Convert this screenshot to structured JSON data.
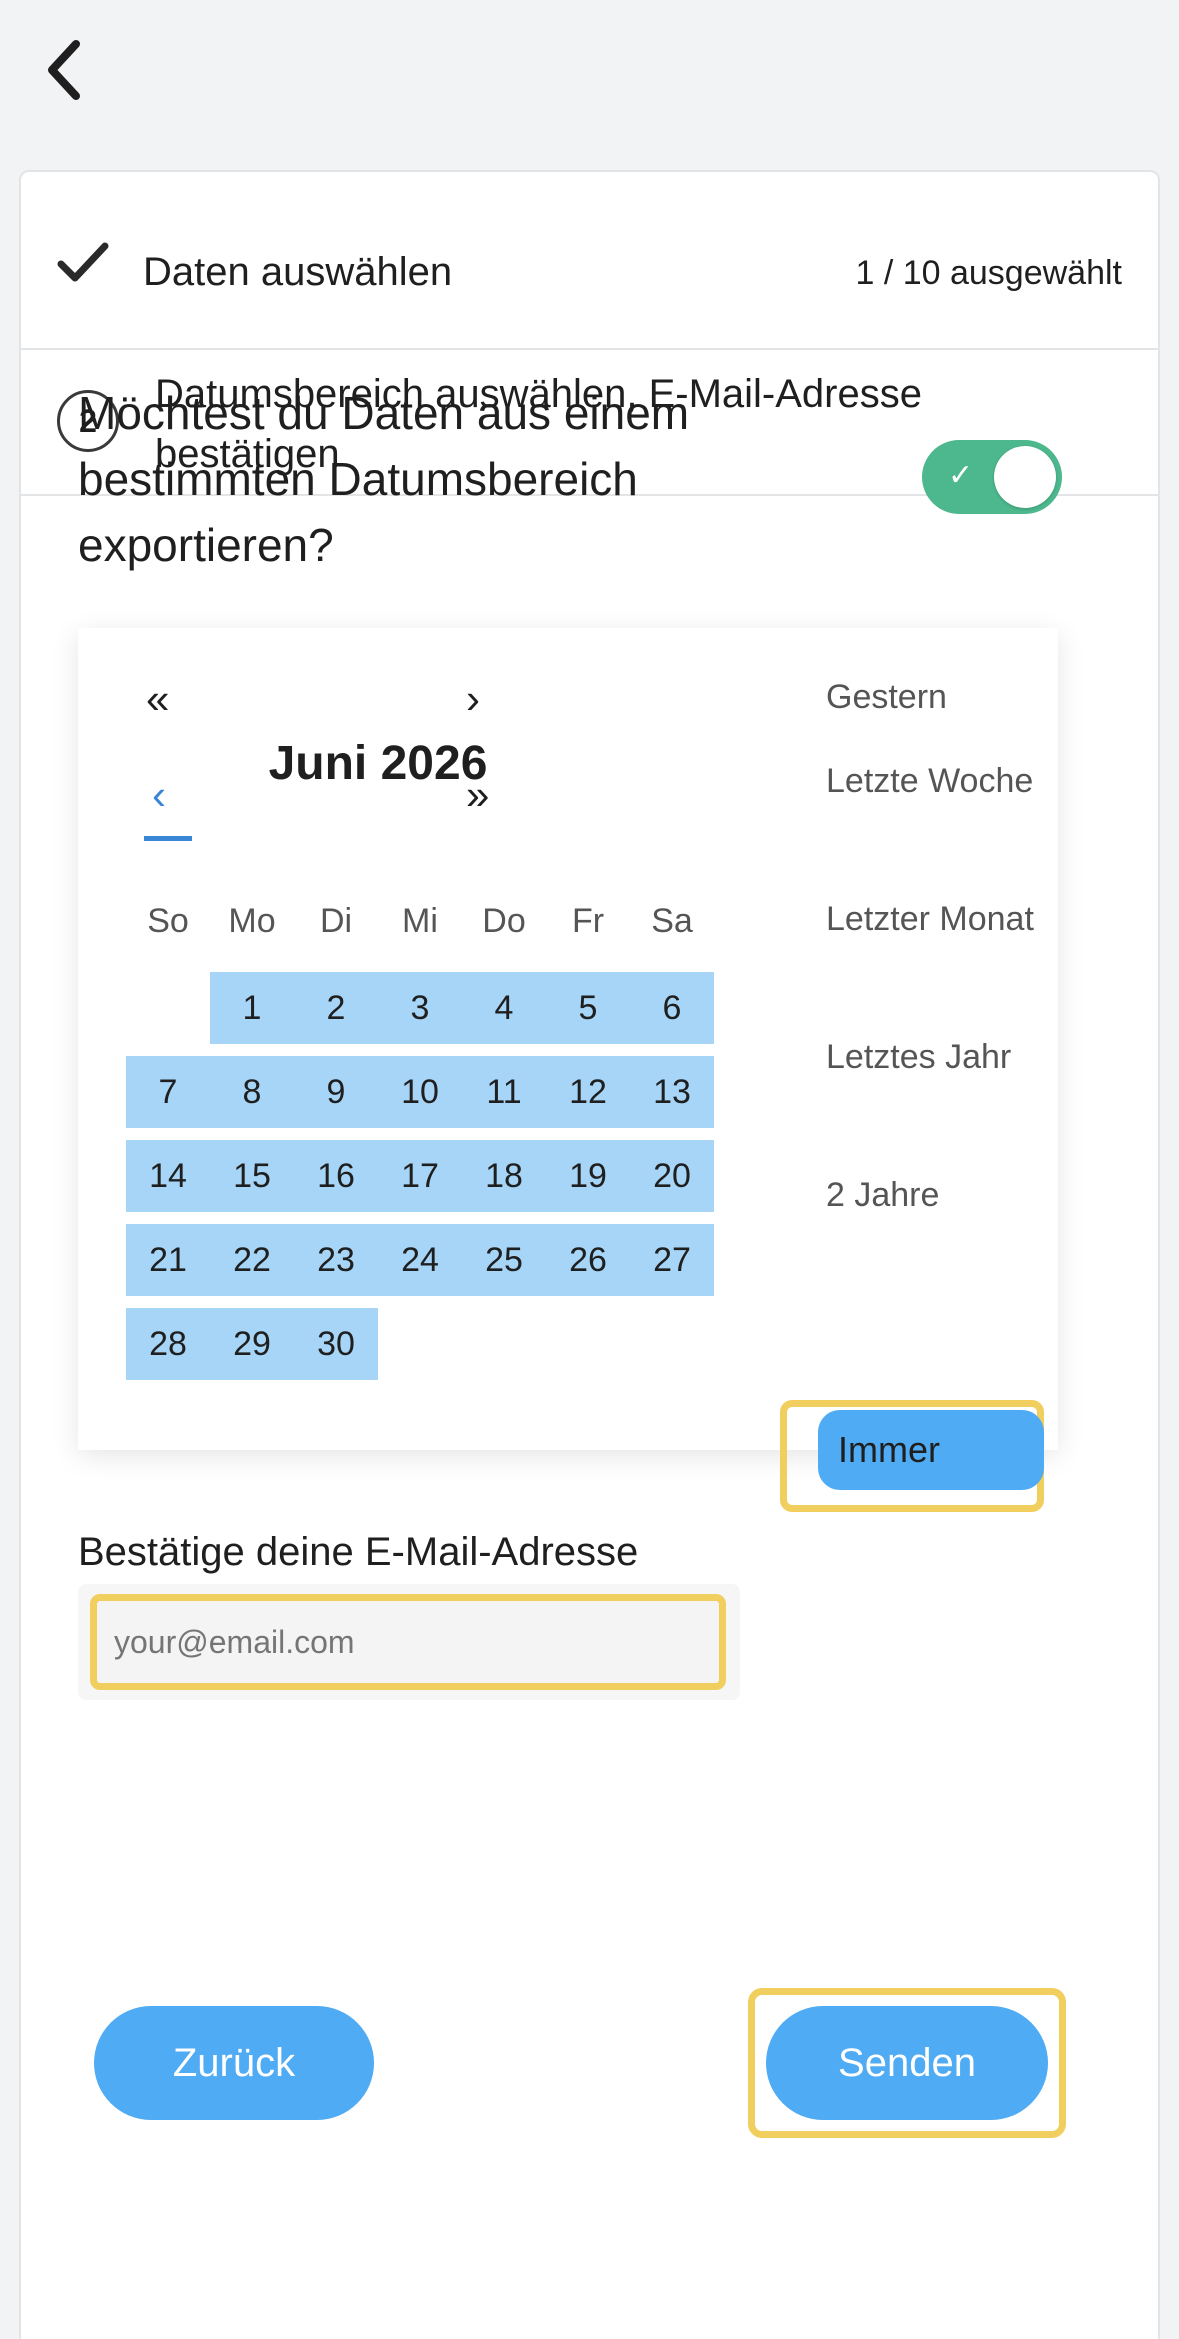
{
  "steps": {
    "step1": {
      "title": "Daten auswählen",
      "count": "1 / 10 ausgewählt"
    },
    "step2": {
      "number": "2",
      "title": "Datumsbereich auswählen, E-Mail-Adresse bestätigen"
    }
  },
  "range": {
    "question": "Möchtest du Daten aus einem bestimmten Datumsbereich exportieren?",
    "toggle_on": true
  },
  "calendar": {
    "month_label": "Juni 2026",
    "weekdays": [
      "So",
      "Mo",
      "Di",
      "Mi",
      "Do",
      "Fr",
      "Sa"
    ],
    "days": [
      "1",
      "2",
      "3",
      "4",
      "5",
      "6",
      "7",
      "8",
      "9",
      "10",
      "11",
      "12",
      "13",
      "14",
      "15",
      "16",
      "17",
      "18",
      "19",
      "20",
      "21",
      "22",
      "23",
      "24",
      "25",
      "26",
      "27",
      "28",
      "29",
      "30"
    ],
    "highlight_color": "#a6d5f8"
  },
  "presets": [
    "Gestern",
    "Letzte Woche",
    "Letzter Monat",
    "Letztes Jahr",
    "2 Jahre",
    "Immer"
  ],
  "selected_preset": "Immer",
  "email": {
    "label": "Bestätige deine E-Mail-Adresse",
    "placeholder": "your@email.com",
    "value": ""
  },
  "buttons": {
    "back": "Zurück",
    "send": "Senden"
  },
  "colors": {
    "accent": "#4fabf4",
    "toggle": "#4db88d",
    "highlight_outline": "#f1cf5e"
  }
}
